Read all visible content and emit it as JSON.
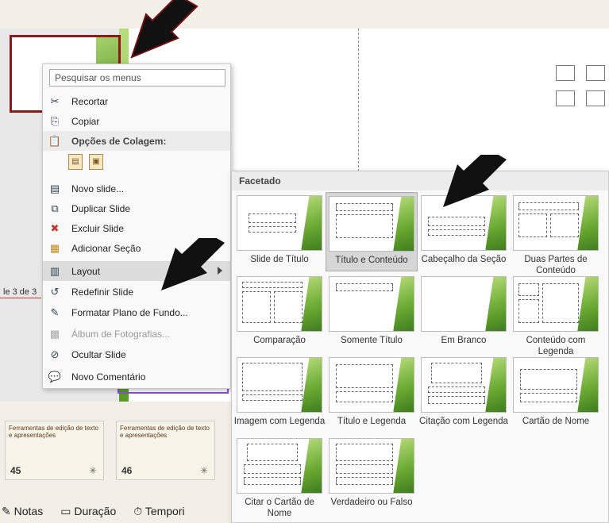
{
  "editor": {
    "slide_counter": "le 3 de 3"
  },
  "context_menu": {
    "search_placeholder": "Pesquisar os menus",
    "items": [
      {
        "label": "Recortar",
        "icon": "scissors-icon"
      },
      {
        "label": "Copiar",
        "icon": "copy-icon"
      },
      {
        "label": "Opções de Colagem:",
        "icon": "clipboard-icon",
        "header": true
      },
      {
        "label": "Novo slide...",
        "icon": "new-slide-icon"
      },
      {
        "label": "Duplicar Slide",
        "icon": "duplicate-slide-icon"
      },
      {
        "label": "Excluir Slide",
        "icon": "delete-slide-icon"
      },
      {
        "label": "Adicionar Seção",
        "icon": "add-section-icon"
      },
      {
        "label": "Layout",
        "icon": "layout-icon",
        "submenu": true,
        "highlighted": true
      },
      {
        "label": "Redefinir Slide",
        "icon": "reset-slide-icon"
      },
      {
        "label": "Formatar Plano de Fundo...",
        "icon": "format-background-icon"
      },
      {
        "label": "Álbum de Fotografias...",
        "icon": "photo-album-icon",
        "disabled": true
      },
      {
        "label": "Ocultar Slide",
        "icon": "hide-slide-icon"
      },
      {
        "label": "Novo Comentário",
        "icon": "new-comment-icon"
      }
    ]
  },
  "layout_gallery": {
    "header": "Facetado",
    "layouts": [
      {
        "label": "Slide de Título",
        "selected": false
      },
      {
        "label": "Título e Conteúdo",
        "selected": true
      },
      {
        "label": "Cabeçalho da Seção",
        "selected": false
      },
      {
        "label": "Duas Partes de Conteúdo",
        "selected": false
      },
      {
        "label": "Comparação",
        "selected": false
      },
      {
        "label": "Somente Título",
        "selected": false
      },
      {
        "label": "Em Branco",
        "selected": false
      },
      {
        "label": "Conteúdo com Legenda",
        "selected": false
      },
      {
        "label": "Imagem com Legenda",
        "selected": false
      },
      {
        "label": "Título e Legenda",
        "selected": false
      },
      {
        "label": "Citação com Legenda",
        "selected": false
      },
      {
        "label": "Cartão de Nome",
        "selected": false
      },
      {
        "label": "Citar o Cartão de Nome",
        "selected": false
      },
      {
        "label": "Verdadeiro ou Falso",
        "selected": false
      }
    ]
  },
  "slide_strip": [
    {
      "number": "45",
      "title": "Ferramentas de edição de texto e apresentações"
    },
    {
      "number": "46",
      "title": "Ferramentas de edição de texto e apresentações"
    }
  ],
  "status_bar": {
    "notes": "Notas",
    "duration": "Duração",
    "timing": "Tempori"
  },
  "colors": {
    "selection_border": "#8b1a1a",
    "theme_green": "#6aaa32",
    "arrow": "#111111"
  }
}
